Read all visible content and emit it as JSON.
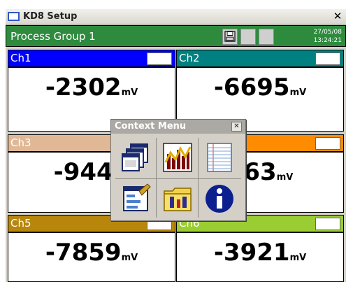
{
  "window": {
    "title": "KD8 Setup",
    "close_glyph": "✕"
  },
  "header": {
    "group_name": "Process Group 1",
    "date": "27/05/08",
    "time": "13:24:21",
    "buttons": [
      "save-icon",
      "blank",
      "blank"
    ]
  },
  "channels": [
    {
      "name": "Ch1",
      "value": "-2302",
      "unit": "mV",
      "color": "#0000ff"
    },
    {
      "name": "Ch2",
      "value": "-6695",
      "unit": "mV",
      "color": "#008080"
    },
    {
      "name": "Ch3",
      "value": "-9440",
      "unit": "",
      "color": "#e0b896"
    },
    {
      "name": "",
      "value": "363",
      "unit": "mV",
      "color": "#ff8c00"
    },
    {
      "name": "Ch5",
      "value": "-7859",
      "unit": "mV",
      "color": "#b8860b"
    },
    {
      "name": "Ch6",
      "value": "-3921",
      "unit": "mV",
      "color": "#9acd32"
    }
  ],
  "context_menu": {
    "title": "Context Menu",
    "close_glyph": "✕",
    "items": [
      {
        "icon": "windows-icon"
      },
      {
        "icon": "bar-chart-icon"
      },
      {
        "icon": "table-icon"
      },
      {
        "icon": "form-icon"
      },
      {
        "icon": "folder-tools-icon"
      },
      {
        "icon": "info-icon"
      }
    ]
  }
}
